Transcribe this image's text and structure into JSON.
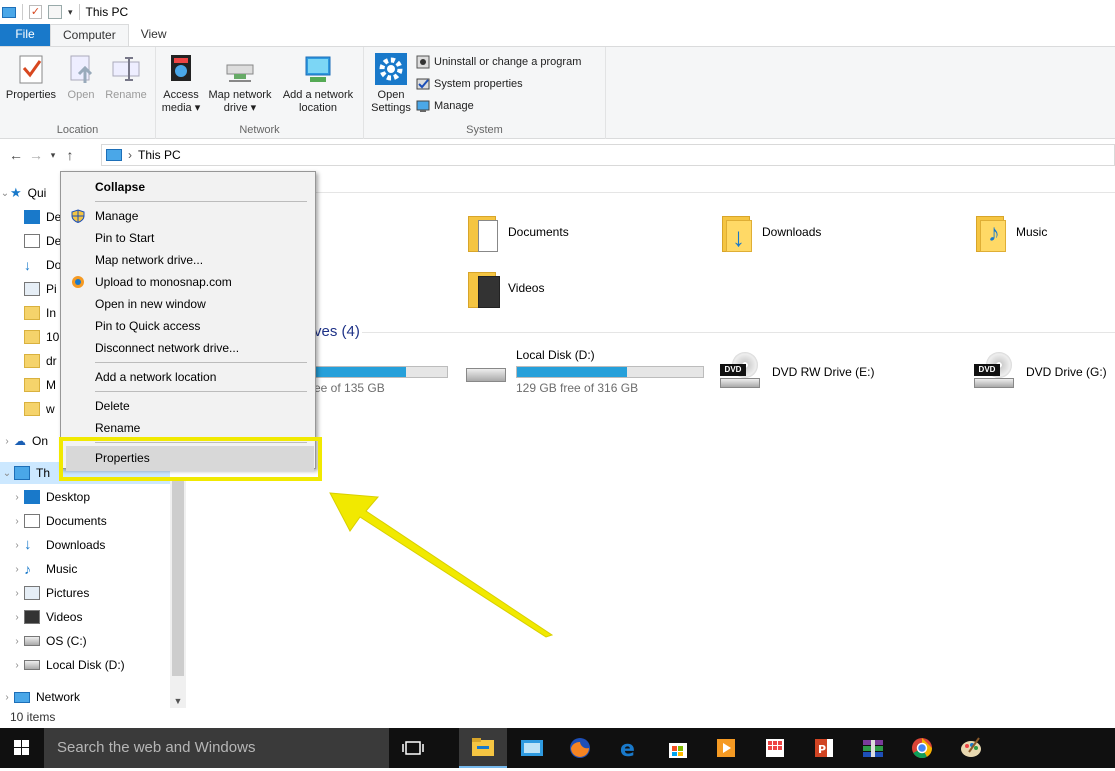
{
  "window": {
    "title": "This PC"
  },
  "tabs": {
    "file": "File",
    "computer": "Computer",
    "view": "View"
  },
  "ribbon": {
    "location": {
      "label": "Location",
      "properties": "Properties",
      "open": "Open",
      "rename": "Rename"
    },
    "network": {
      "label": "Network",
      "access_media": [
        "Access",
        "media"
      ],
      "map_drive": [
        "Map network",
        "drive"
      ],
      "add_location": [
        "Add a network",
        "location"
      ]
    },
    "system": {
      "label": "System",
      "open_settings": [
        "Open",
        "Settings"
      ],
      "uninstall": "Uninstall or change a program",
      "system_properties": "System properties",
      "manage": "Manage"
    }
  },
  "address": {
    "path": "This PC"
  },
  "navpane": {
    "quick_access": "Qui",
    "quick_items": [
      "De",
      "De",
      "Do",
      "Pi",
      "In",
      "10",
      "dr",
      "M",
      "w"
    ],
    "onedrive": "On",
    "this_pc": "Th",
    "pc_items": [
      "Desktop",
      "Documents",
      "Downloads",
      "Music",
      "Pictures",
      "Videos",
      "OS (C:)",
      "Local Disk (D:)"
    ],
    "network": "Network"
  },
  "content": {
    "folders": [
      "Documents",
      "Downloads",
      "Music",
      "Videos"
    ],
    "drives_heading": "ves (4)",
    "drives": [
      {
        "name": "",
        "free": "ree of 135 GB",
        "used_fraction": 0.7
      },
      {
        "name": "Local Disk (D:)",
        "free": "129 GB free of 316 GB",
        "used_fraction": 0.59
      },
      {
        "name": "DVD RW Drive (E:)"
      },
      {
        "name": "DVD Drive (G:)"
      }
    ],
    "dvd_badge": "DVD"
  },
  "context_menu": {
    "collapse": "Collapse",
    "manage": "Manage",
    "pin_start": "Pin to Start",
    "map_drive": "Map network drive...",
    "upload": "Upload to monosnap.com",
    "open_new": "Open in new window",
    "pin_quick": "Pin to Quick access",
    "disconnect": "Disconnect network drive...",
    "add_location": "Add a network location",
    "delete": "Delete",
    "rename": "Rename",
    "properties": "Properties"
  },
  "status": {
    "items": "10 items"
  },
  "taskbar": {
    "search_placeholder": "Search the web and Windows"
  },
  "colors": {
    "accent": "#1979ca",
    "highlight": "#f1e900",
    "bar_fill": "#26a0da"
  }
}
